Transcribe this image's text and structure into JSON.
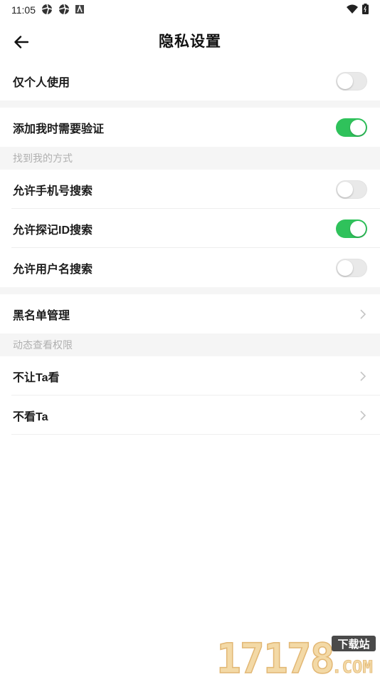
{
  "status_bar": {
    "time": "11:05"
  },
  "header": {
    "title": "隐私设置"
  },
  "rows": {
    "personal_only": {
      "label": "仅个人使用",
      "enabled": false
    },
    "verify_add": {
      "label": "添加我时需要验证",
      "enabled": true
    },
    "phone_search": {
      "label": "允许手机号搜索",
      "enabled": false
    },
    "id_search": {
      "label": "允许探记ID搜索",
      "enabled": true
    },
    "username_search": {
      "label": "允许用户名搜索",
      "enabled": false
    },
    "blacklist": {
      "label": "黑名单管理"
    },
    "hide_from": {
      "label": "不让Ta看"
    },
    "dont_view": {
      "label": "不看Ta"
    }
  },
  "sections": {
    "find_me": "找到我的方式",
    "moments_permission": "动态查看权限"
  },
  "watermark": {
    "number": "17178",
    "badge": "下载站",
    "suffix": ".COM"
  },
  "colors": {
    "toggle_on": "#2fc25b",
    "toggle_off": "#e9e9e9",
    "section_bg": "#f5f5f5"
  }
}
